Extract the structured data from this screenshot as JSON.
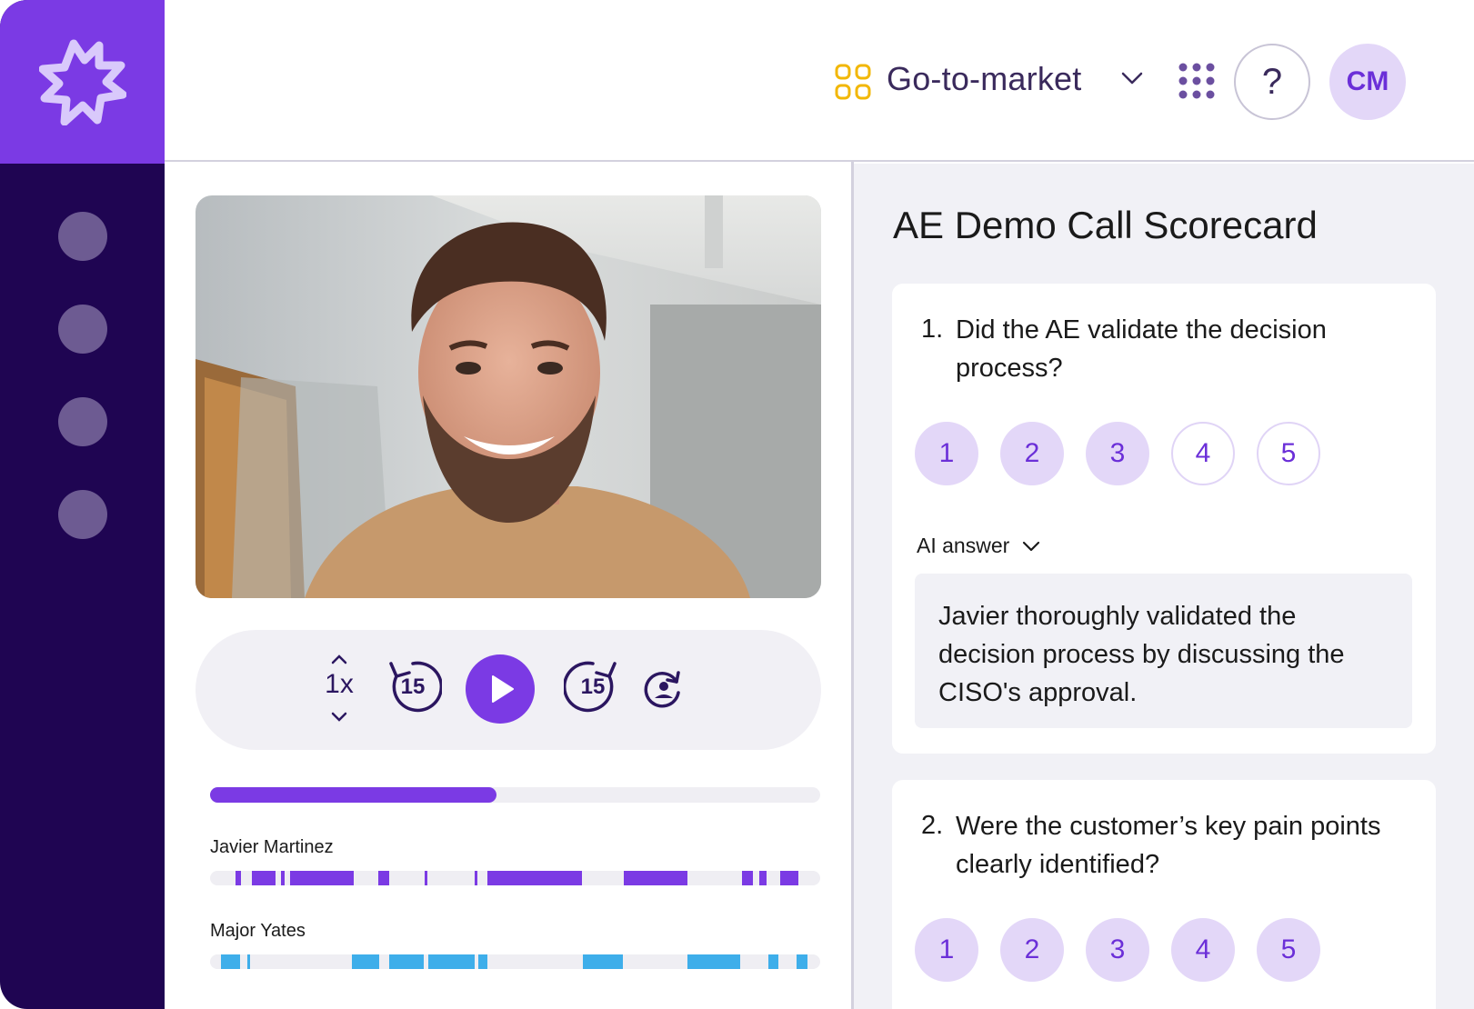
{
  "workspace": {
    "name": "Go-to-market"
  },
  "user": {
    "initials": "CM"
  },
  "help": {
    "label": "?"
  },
  "player": {
    "speed_label": "1x",
    "rewind_label": "15",
    "forward_label": "15",
    "progress_fraction": 0.47
  },
  "speakers": [
    {
      "name": "Javier Martinez",
      "color": "#7b3ae4"
    },
    {
      "name": "Major Yates",
      "color": "#3eaeea"
    }
  ],
  "scorecard": {
    "title": "AE Demo Call Scorecard",
    "questions": [
      {
        "number": "1.",
        "text": "Did the AE validate the decision process?",
        "ratings": [
          "1",
          "2",
          "3",
          "4",
          "5"
        ],
        "selected_up_to": 3,
        "ai_label": "AI answer",
        "ai_answer": "Javier thoroughly validated the decision process by discussing the CISO's approval."
      },
      {
        "number": "2.",
        "text": "Were the customer’s key pain points clearly identified?",
        "ratings": [
          "1",
          "2",
          "3",
          "4",
          "5"
        ],
        "selected_up_to": 5
      }
    ]
  },
  "colors": {
    "brand_purple": "#7b3ae4",
    "sidebar_dark": "#1f0552",
    "accent_yellow": "#f2b705",
    "speaker_blue": "#3eaeea"
  }
}
